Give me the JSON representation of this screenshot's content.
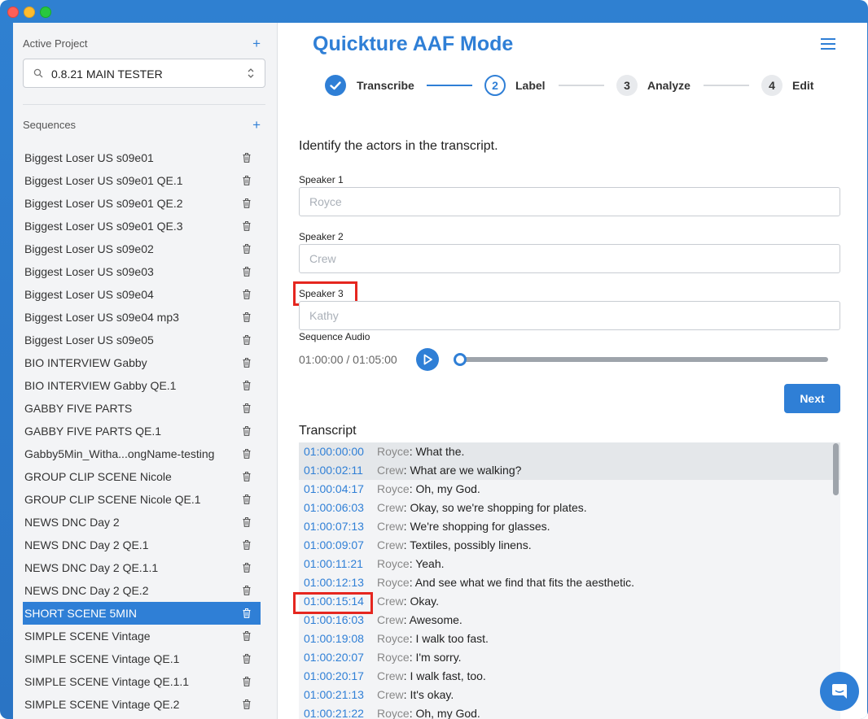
{
  "sidebar": {
    "active_project_label": "Active Project",
    "add_project_icon": "plus-icon",
    "project_value": "0.8.21 MAIN TESTER",
    "sequences_label": "Sequences",
    "add_sequence_icon": "plus-icon",
    "plus_glyph": "+",
    "selected_index": 20,
    "sequences": [
      "Biggest Loser US s09e01",
      "Biggest Loser US s09e01 QE.1",
      "Biggest Loser US s09e01 QE.2",
      "Biggest Loser US s09e01 QE.3",
      "Biggest Loser US s09e02",
      "Biggest Loser US s09e03",
      "Biggest Loser US s09e04",
      "Biggest Loser US s09e04 mp3",
      "Biggest Loser US s09e05",
      "BIO INTERVIEW Gabby",
      "BIO INTERVIEW Gabby QE.1",
      "GABBY FIVE PARTS",
      "GABBY FIVE PARTS QE.1",
      "Gabby5Min_Witha...ongName-testing",
      "GROUP CLIP SCENE Nicole",
      "GROUP CLIP SCENE Nicole QE.1",
      "NEWS DNC Day 2",
      "NEWS DNC Day 2 QE.1",
      "NEWS DNC Day 2 QE.1.1",
      "NEWS DNC Day 2 QE.2",
      "SHORT SCENE 5MIN",
      "SIMPLE SCENE Vintage",
      "SIMPLE SCENE Vintage QE.1",
      "SIMPLE SCENE Vintage QE.1.1",
      "SIMPLE SCENE Vintage QE.2"
    ]
  },
  "header": {
    "title": "Quickture AAF Mode",
    "menu_icon": "hamburger-icon"
  },
  "steps": [
    {
      "number": "",
      "label": "Transcribe",
      "state": "done"
    },
    {
      "number": "2",
      "label": "Label",
      "state": "active"
    },
    {
      "number": "3",
      "label": "Analyze",
      "state": "pending"
    },
    {
      "number": "4",
      "label": "Edit",
      "state": "pending"
    }
  ],
  "labeling": {
    "prompt": "Identify the actors in the transcript.",
    "speakers": [
      {
        "label": "Speaker 1",
        "placeholder": "Royce"
      },
      {
        "label": "Speaker 2",
        "placeholder": "Crew"
      },
      {
        "label": "Speaker 3",
        "placeholder": "Kathy"
      }
    ]
  },
  "audio": {
    "label": "Sequence Audio",
    "time_display": "01:00:00 / 01:05:00",
    "progress": 0.0,
    "play_icon": "play-icon"
  },
  "next_button": "Next",
  "transcript": {
    "title": "Transcript",
    "rows": [
      {
        "time": "01:00:00:00",
        "speaker": "Royce",
        "text": ": What the."
      },
      {
        "time": "01:00:02:11",
        "speaker": "Crew",
        "text": ": What are we walking?"
      },
      {
        "time": "01:00:04:17",
        "speaker": "Royce",
        "text": ": Oh, my God."
      },
      {
        "time": "01:00:06:03",
        "speaker": "Crew",
        "text": ": Okay, so we're shopping for plates."
      },
      {
        "time": "01:00:07:13",
        "speaker": "Crew",
        "text": ": We're shopping for glasses."
      },
      {
        "time": "01:00:09:07",
        "speaker": "Crew",
        "text": ": Textiles, possibly linens."
      },
      {
        "time": "01:00:11:21",
        "speaker": "Royce",
        "text": ": Yeah."
      },
      {
        "time": "01:00:12:13",
        "speaker": "Royce",
        "text": ": And see what we find that fits the aesthetic."
      },
      {
        "time": "01:00:15:14",
        "speaker": "Crew",
        "text": ": Okay."
      },
      {
        "time": "01:00:16:03",
        "speaker": "Crew",
        "text": ": Awesome."
      },
      {
        "time": "01:00:19:08",
        "speaker": "Royce",
        "text": ": I walk too fast."
      },
      {
        "time": "01:00:20:07",
        "speaker": "Royce",
        "text": ": I'm sorry."
      },
      {
        "time": "01:00:20:17",
        "speaker": "Crew",
        "text": ": I walk fast, too."
      },
      {
        "time": "01:00:21:13",
        "speaker": "Crew",
        "text": ": It's okay."
      },
      {
        "time": "01:00:21:22",
        "speaker": "Royce",
        "text": ": Oh, my God."
      }
    ],
    "shaded_rows": [
      0,
      1
    ]
  },
  "chat_icon": "chat-bubble-icon",
  "colors": {
    "accent": "#2f7fd6",
    "highlight": "#e5261f",
    "window_frame": "#2f80d1"
  }
}
